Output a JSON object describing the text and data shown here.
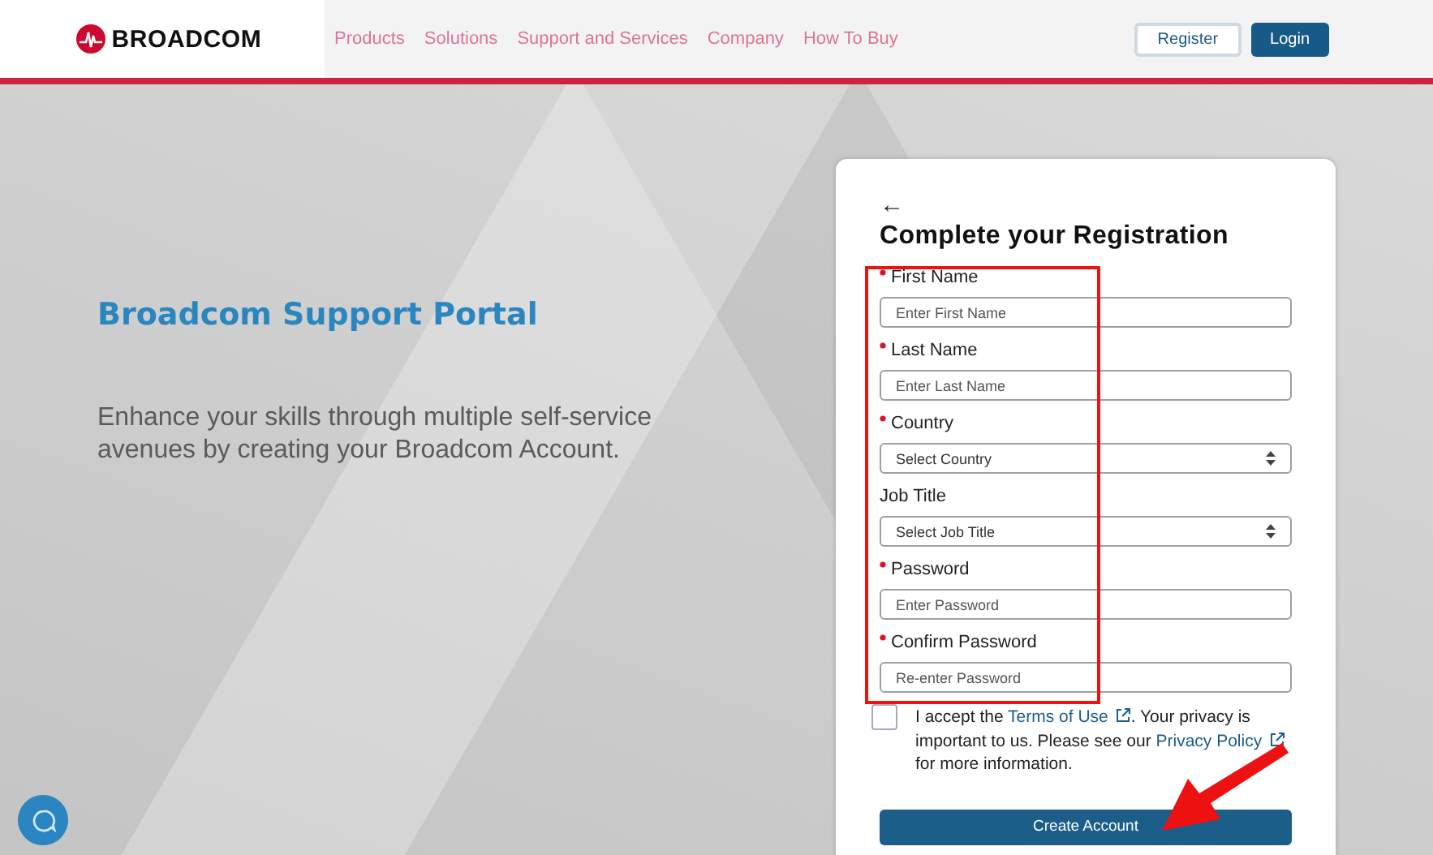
{
  "header": {
    "logo": "BROADCOM",
    "nav": [
      "Products",
      "Solutions",
      "Support and Services",
      "Company",
      "How To Buy"
    ],
    "buttons": [
      "Register",
      "Login"
    ]
  },
  "hero": {
    "title": "Broadcom Support Portal",
    "text": "Enhance your skills through multiple self-service avenues by creating your Broadcom Account."
  },
  "form": {
    "back": "←",
    "title": "Complete your Registration",
    "fields": [
      {
        "label": "First Name",
        "required": true,
        "kind": "text",
        "placeholder": "Enter First Name"
      },
      {
        "label": "Last Name",
        "required": true,
        "kind": "text",
        "placeholder": "Enter Last Name"
      },
      {
        "label": "Country",
        "required": true,
        "kind": "select",
        "placeholder": "Select Country"
      },
      {
        "label": "Job Title",
        "required": false,
        "kind": "select",
        "placeholder": "Select Job Title"
      },
      {
        "label": "Password",
        "required": true,
        "kind": "text",
        "placeholder": "Enter Password"
      },
      {
        "label": "Confirm Password",
        "required": true,
        "kind": "text",
        "placeholder": "Re-enter Password"
      }
    ],
    "consent": {
      "checked": false,
      "before": "I accept the",
      "terms": "Terms of Use",
      "middle": ". Your privacy is important to us. Please see our",
      "privacy": "Privacy Policy",
      "after": "for more information."
    },
    "submit": "Create Account"
  }
}
